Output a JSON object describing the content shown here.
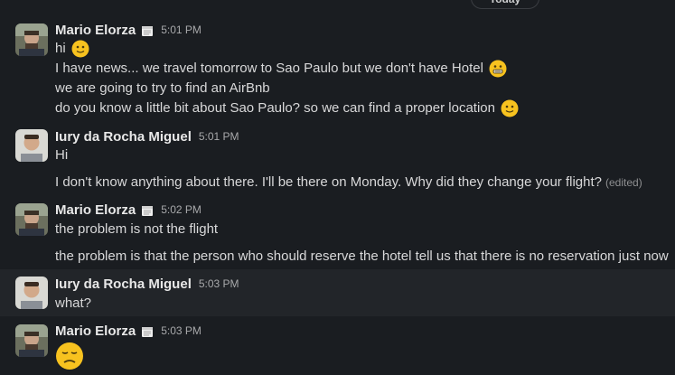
{
  "day_divider": "Today",
  "messages": [
    {
      "author": "Mario Elorza",
      "time": "5:01 PM",
      "lines": [
        "hi",
        "I have news... we travel tomorrow to Sao Paulo but we don't have Hotel",
        "we are going to try to find an AirBnb",
        "do you know a little bit about Sao Paulo? so we can find a proper location"
      ]
    },
    {
      "author": "Iury da Rocha Miguel",
      "time": "5:01 PM",
      "lines": [
        "Hi",
        "I don't know anything about there. I'll be there on Monday. Why did they change your flight?"
      ],
      "edited_label": "(edited)"
    },
    {
      "author": "Mario Elorza",
      "time": "5:02 PM",
      "lines": [
        "the problem is not the flight",
        "the problem is that the person who should reserve the hotel tell us that there is no reservation just now"
      ]
    },
    {
      "author": "Iury da Rocha Miguel",
      "time": "5:03 PM",
      "lines": [
        "what?"
      ]
    },
    {
      "author": "Mario Elorza",
      "time": "5:03 PM",
      "lines": []
    }
  ],
  "icons": {
    "status": "calendar-icon",
    "emoji_smile": "slightly-smiling-face-emoji",
    "emoji_grimace": "grimacing-face-emoji",
    "emoji_disappointed": "disappointed-face-emoji"
  }
}
